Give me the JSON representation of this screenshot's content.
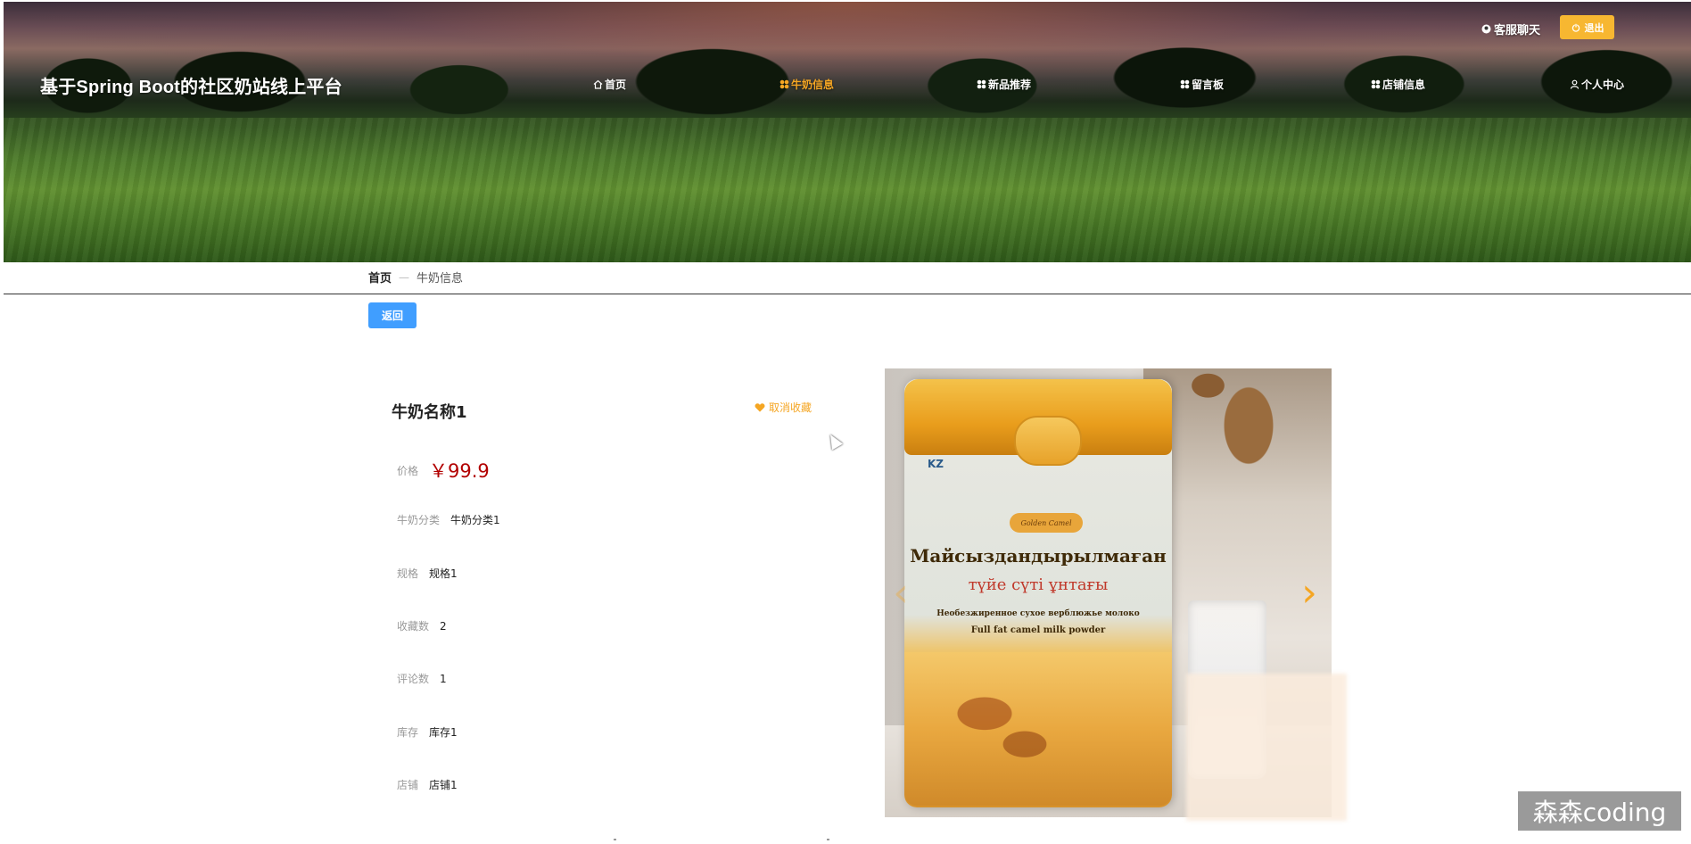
{
  "header": {
    "site_title": "基于Spring Boot的社区奶站线上平台",
    "chat_label": "客服聊天",
    "logout_label": "退出"
  },
  "nav": {
    "items": [
      {
        "label": "首页",
        "icon": "home-icon",
        "active": false
      },
      {
        "label": "牛奶信息",
        "icon": "grid-icon",
        "active": true
      },
      {
        "label": "新品推荐",
        "icon": "grid-icon",
        "active": false
      },
      {
        "label": "留言板",
        "icon": "grid-icon",
        "active": false
      },
      {
        "label": "店铺信息",
        "icon": "grid-icon",
        "active": false
      },
      {
        "label": "个人中心",
        "icon": "user-icon",
        "active": false
      }
    ]
  },
  "breadcrumb": {
    "home": "首页",
    "separator": "—",
    "current": "牛奶信息"
  },
  "back_label": "返回",
  "product": {
    "name": "牛奶名称1",
    "favorite_label": "取消收藏",
    "price_label": "价格",
    "price_value": "￥99.9",
    "fields": [
      {
        "label": "牛奶分类",
        "value": "牛奶分类1"
      },
      {
        "label": "规格",
        "value": "规格1"
      },
      {
        "label": "收藏数",
        "value": "2"
      },
      {
        "label": "评论数",
        "value": "1"
      },
      {
        "label": "库存",
        "value": "库存1"
      },
      {
        "label": "店铺",
        "value": "店铺1"
      }
    ]
  },
  "carousel": {
    "image_text": {
      "brand": "Golden Camel",
      "kz": "KZ",
      "title": "Майсыздандырылмаған",
      "subtitle": "түйе сүті ұнтағы",
      "line1": "Необезжиренное сухое верблюжье молоко",
      "line2": "Full fat camel milk powder"
    },
    "prev_arrow": "‹",
    "next_arrow": "›"
  },
  "watermark": "森森coding",
  "colors": {
    "accent": "#f5a623",
    "primary_button": "#409eff",
    "logout_button": "#f7b731",
    "price": "#b20000"
  }
}
